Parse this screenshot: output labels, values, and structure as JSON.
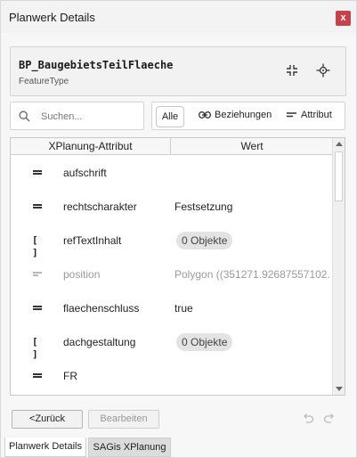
{
  "window": {
    "title": "Planwerk Details",
    "close_label": "x"
  },
  "feature": {
    "name": "BP_BaugebietsTeilFlaeche",
    "type": "FeatureType"
  },
  "search": {
    "placeholder": "Suchen..."
  },
  "filters": {
    "all": "Alle",
    "relations": "Beziehungen",
    "attribute": "Attribut"
  },
  "table": {
    "col_attribute": "XPlanung-Attribut",
    "col_value": "Wert",
    "rows": [
      {
        "icon": "equals-icon",
        "name": "aufschrift",
        "value": "",
        "muted": false,
        "pill": false
      },
      {
        "icon": "equals-icon",
        "name": "rechtscharakter",
        "value": "Festsetzung",
        "muted": false,
        "pill": false
      },
      {
        "icon": "list-icon",
        "name": "refTextInhalt",
        "value": "0 Objekte",
        "muted": false,
        "pill": true
      },
      {
        "icon": "equals-icon",
        "name": "position",
        "value": "Polygon ((351271.92687557102...",
        "muted": true,
        "pill": false
      },
      {
        "icon": "equals-icon",
        "name": "flaechenschluss",
        "value": "true",
        "muted": false,
        "pill": false
      },
      {
        "icon": "list-icon",
        "name": "dachgestaltung",
        "value": "0 Objekte",
        "muted": false,
        "pill": true
      },
      {
        "icon": "equals-icon",
        "name": "FR",
        "value": "",
        "muted": false,
        "pill": false
      }
    ]
  },
  "buttons": {
    "back": "<Zurück",
    "edit": "Bearbeiten"
  },
  "tabs": [
    "Planwerk Details",
    "SAGis XPlanung"
  ],
  "list_icon_glyph": "[ ]",
  "colors": {
    "close": "#c4424a"
  }
}
